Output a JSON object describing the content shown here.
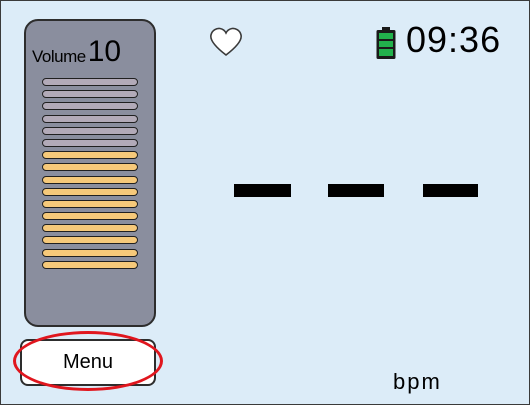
{
  "volume": {
    "label": "Volume",
    "value": "10",
    "level": 10,
    "segments": 16,
    "on_color": "#f6c97a",
    "off_color": "#b2aab8"
  },
  "status": {
    "time": "09:36",
    "battery_color": "#22b14c",
    "heart_icon": "heart-outline-icon",
    "battery_icon": "battery-full-icon"
  },
  "reading": {
    "value": "– – –",
    "unit": "bpm"
  },
  "menu": {
    "label": "Menu",
    "highlight_color": "#e0161e"
  }
}
